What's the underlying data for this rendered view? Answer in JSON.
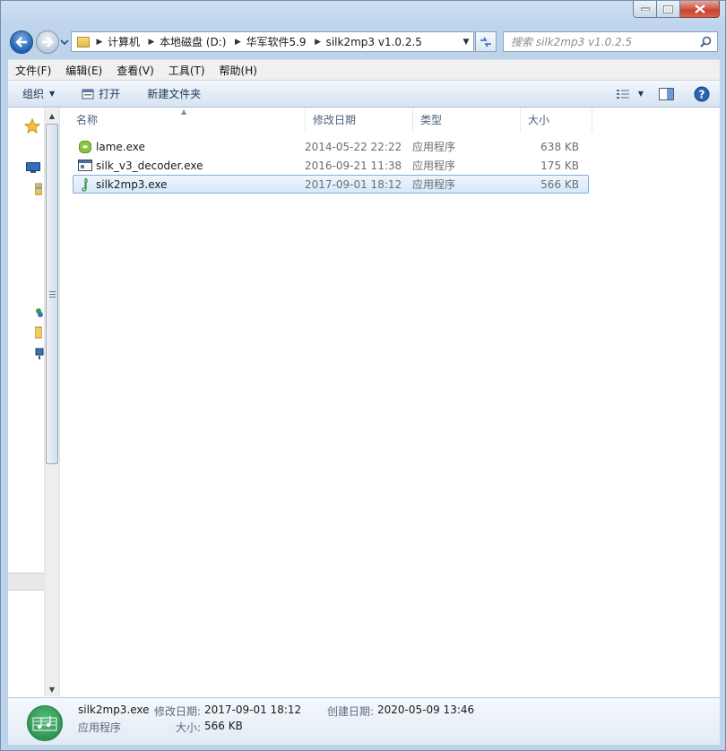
{
  "window": {
    "caption": {
      "minimize": "minimize",
      "maximize": "maximize",
      "close": "close"
    }
  },
  "address": {
    "breadcrumbs": [
      "计算机",
      "本地磁盘 (D:)",
      "华军软件5.9",
      "silk2mp3 v1.0.2.5"
    ]
  },
  "search": {
    "placeholder": "搜索 silk2mp3 v1.0.2.5"
  },
  "menu": [
    {
      "label": "文件(F)"
    },
    {
      "label": "编辑(E)"
    },
    {
      "label": "查看(V)"
    },
    {
      "label": "工具(T)"
    },
    {
      "label": "帮助(H)"
    }
  ],
  "toolbar": {
    "organize": "组织",
    "open": "打开",
    "new_folder": "新建文件夹"
  },
  "columns": {
    "name": "名称",
    "date": "修改日期",
    "type": "类型",
    "size": "大小"
  },
  "files": [
    {
      "name": "lame.exe",
      "date": "2014-05-22 22:22",
      "type": "应用程序",
      "size": "638 KB",
      "icon": "lame-app-icon",
      "selected": false
    },
    {
      "name": "silk_v3_decoder.exe",
      "date": "2016-09-21 11:38",
      "type": "应用程序",
      "size": "175 KB",
      "icon": "console-app-icon",
      "selected": false
    },
    {
      "name": "silk2mp3.exe",
      "date": "2017-09-01 18:12",
      "type": "应用程序",
      "size": "566 KB",
      "icon": "music-note-icon",
      "selected": true
    }
  ],
  "details": {
    "name": "silk2mp3.exe",
    "type": "应用程序",
    "modified_label": "修改日期:",
    "modified_value": "2017-09-01 18:12",
    "created_label": "创建日期:",
    "created_value": "2020-05-09 13:46",
    "size_label": "大小:",
    "size_value": "566 KB"
  },
  "colors": {
    "selection_border": "#84acdd",
    "header_text": "#4c607a",
    "toolbar_text": "#1e395b"
  }
}
